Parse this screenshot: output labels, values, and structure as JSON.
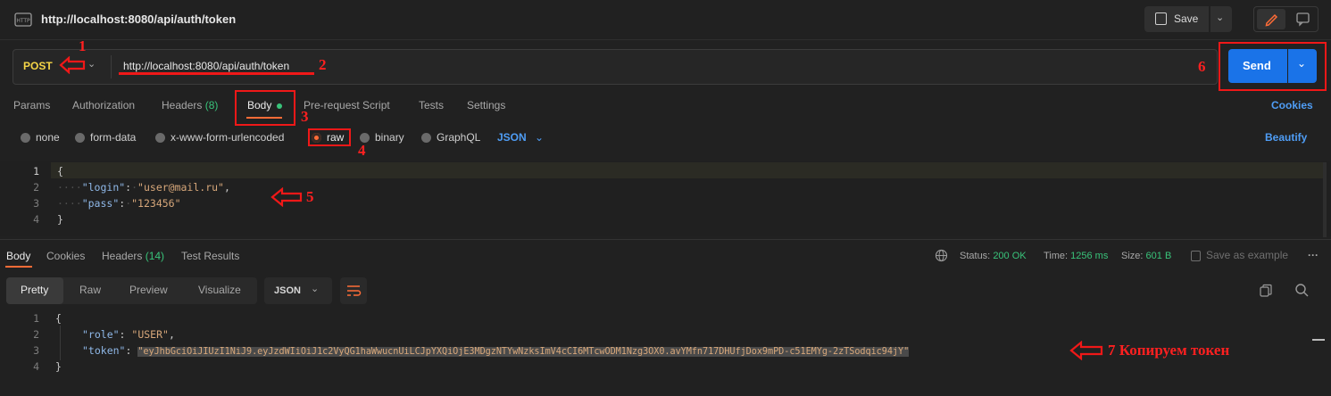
{
  "window": {
    "title": "http://localhost:8080/api/auth/token",
    "save_label": "Save"
  },
  "request": {
    "method": "POST",
    "url": "http://localhost:8080/api/auth/token",
    "send_label": "Send",
    "tabs": [
      "Params",
      "Authorization",
      "Headers",
      "(8)",
      "Body",
      "Pre-request Script",
      "Tests",
      "Settings"
    ],
    "cookies_label": "Cookies"
  },
  "body_types": {
    "none": "none",
    "form_data": "form-data",
    "urlencoded": "x-www-form-urlencoded",
    "raw": "raw",
    "binary": "binary",
    "graphql": "GraphQL",
    "format": "JSON",
    "beautify": "Beautify"
  },
  "request_body": {
    "line_numbers": [
      "1",
      "2",
      "3",
      "4"
    ],
    "open": "{",
    "login_key": "\"login\"",
    "login_value": "\"user@mail.ru\"",
    "pass_key": "\"pass\"",
    "pass_value": "\"123456\"",
    "close": "}"
  },
  "response": {
    "tabs": [
      "Body",
      "Cookies",
      "Headers",
      "(14)",
      "Test Results"
    ],
    "status_label": "Status:",
    "status_value": "200 OK",
    "time_label": "Time:",
    "time_value": "1256 ms",
    "size_label": "Size:",
    "size_value": "601 B",
    "save_example": "Save as example",
    "view_tabs": [
      "Pretty",
      "Raw",
      "Preview",
      "Visualize"
    ],
    "format": "JSON",
    "line_numbers": [
      "1",
      "2",
      "3",
      "4"
    ],
    "open": "{",
    "role_key": "\"role\"",
    "role_value": "\"USER\"",
    "token_key": "\"token\"",
    "token_value": "\"eyJhbGciOiJIUzI1NiJ9.eyJzdWIiOiJ1c2VyQG1haWwucnUiLCJpYXQiOjE3MDgzNTYwNzksImV4cCI6MTcwODM1Nzg3OX0.avYMfn717DHUfjDox9mPD-c51EMYg-2zTSodqic94jY\"",
    "close": "}"
  },
  "annotations": {
    "n1": "1",
    "n2": "2",
    "n3": "3",
    "n4": "4",
    "n5": "5",
    "n6": "6",
    "n7": "7 Копируем токен"
  },
  "colors": {
    "accent_blue": "#1a73e8",
    "annotation_red": "#f01818",
    "method_yellow": "#f5d547",
    "status_green": "#39c37a"
  }
}
